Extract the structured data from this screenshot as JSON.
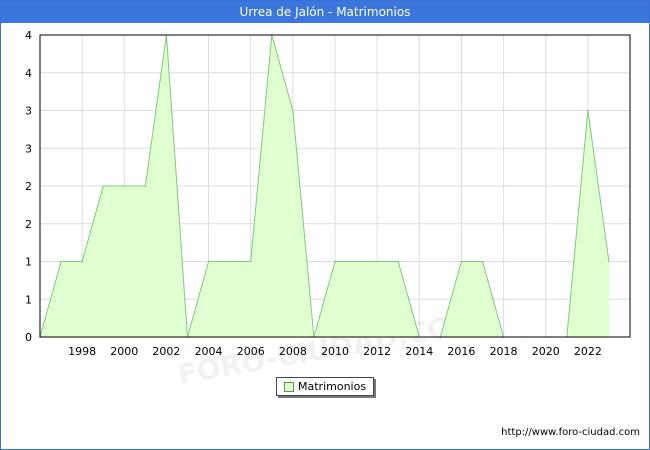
{
  "title": "Urrea de Jalón - Matrimonios",
  "footer_url": "http://www.foro-ciudad.com",
  "watermark": "FORO-CIUDAD.COM",
  "colors": {
    "title_bar": "#3a76dc",
    "area_fill": "#e0ffd0",
    "line": "#80c880",
    "grid": "#dddddd"
  },
  "chart_data": {
    "type": "area",
    "title": "Urrea de Jalón - Matrimonios",
    "x": [
      1996,
      1997,
      1998,
      1999,
      2000,
      2001,
      2002,
      2003,
      2004,
      2005,
      2006,
      2007,
      2008,
      2009,
      2010,
      2011,
      2012,
      2013,
      2014,
      2015,
      2016,
      2017,
      2018,
      2019,
      2020,
      2021,
      2022,
      2023
    ],
    "series": [
      {
        "name": "Matrimonios",
        "values": [
          0,
          1,
          1,
          2,
          2,
          2,
          4,
          0,
          1,
          1,
          1,
          4,
          3,
          0,
          1,
          1,
          1,
          1,
          0,
          0,
          1,
          1,
          0,
          0,
          0,
          0,
          3,
          1
        ]
      }
    ],
    "x_tick_labels": [
      "1998",
      "2000",
      "2002",
      "2004",
      "2006",
      "2008",
      "2010",
      "2012",
      "2014",
      "2016",
      "2018",
      "2020",
      "2022"
    ],
    "y_tick_labels": [
      "0",
      "1",
      "1",
      "2",
      "2",
      "3",
      "3",
      "4",
      "4"
    ],
    "xlim": [
      1996,
      2024
    ],
    "ylim": [
      0,
      4
    ],
    "grid": true,
    "legend": "bottom-center"
  }
}
